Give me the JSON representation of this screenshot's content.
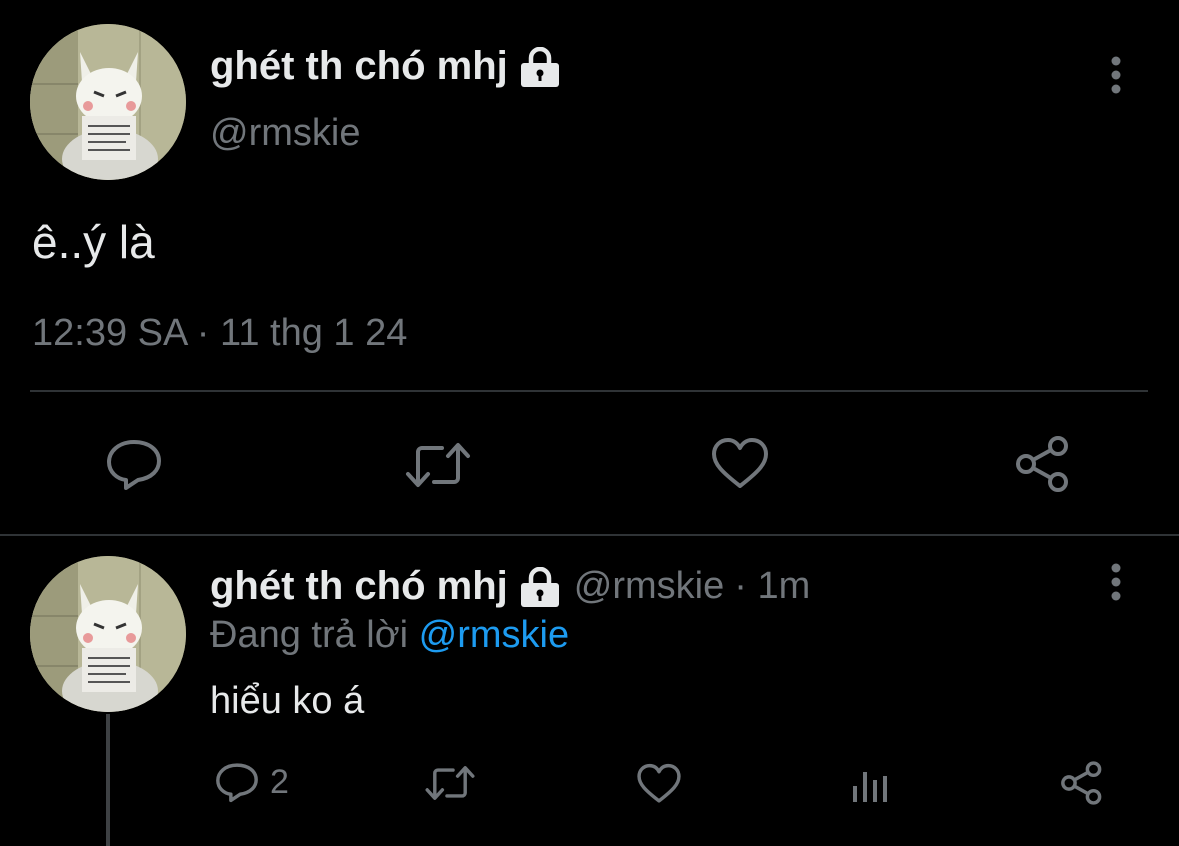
{
  "main_tweet": {
    "display_name": "ghét th chó mhj",
    "handle": "@rmskie",
    "text": "ê..ý là",
    "timestamp": "12:39 SA · 11 thg 1 24",
    "lock_icon": "lock-icon"
  },
  "reply_tweet": {
    "display_name": "ghét th chó mhj",
    "handle": "@rmskie",
    "time": "· 1m",
    "replying_prefix": "Đang trả lời",
    "replying_to": "@rmskie",
    "text": "hiểu ko á",
    "reply_count": "2"
  },
  "colors": {
    "background": "#000000",
    "text": "#e7e9ea",
    "secondary": "#71767b",
    "accent": "#1d9bf0",
    "divider": "#2f3336"
  }
}
